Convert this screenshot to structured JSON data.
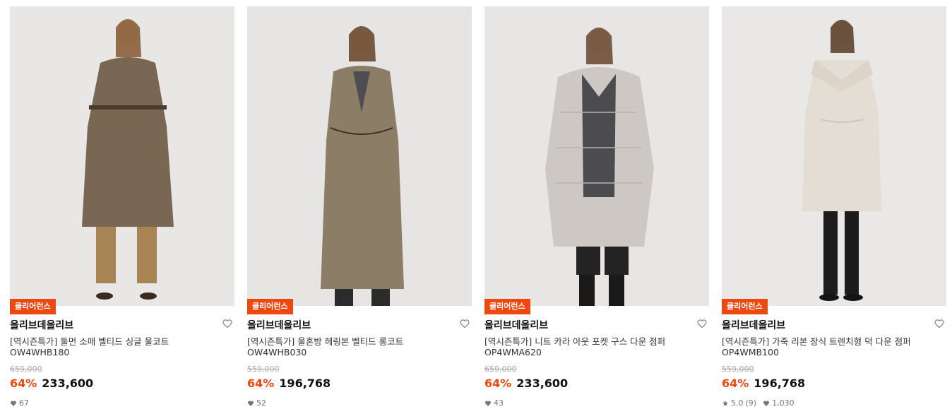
{
  "products": [
    {
      "badge": "클리어런스",
      "brand": "올리브데올리브",
      "name": "[역시즌특가] 둘먼 소매 벨티드 싱글 울코트",
      "code": "OW4WHB180",
      "original_price": "659,000",
      "discount_rate": "64%",
      "sale_price": "233,600",
      "likes": "67",
      "photo": {
        "bg": "#e8e7e5",
        "coat": "#7a6753",
        "pants": "#a88354",
        "shoe": "#3b2a20"
      }
    },
    {
      "badge": "클리어런스",
      "brand": "올리브데올리브",
      "name": "[역시즌특가] 울혼방 헤링본 벨티드 롱코트",
      "code": "OW4WHB030",
      "original_price": "559,000",
      "discount_rate": "64%",
      "sale_price": "196,768",
      "likes": "52",
      "photo": {
        "bg": "#e6e5e3",
        "coat": "#8c7d67",
        "pants": "#2b2b2b",
        "shoe": "#1e1e1e"
      }
    },
    {
      "badge": "클리어런스",
      "brand": "올리브데올리브",
      "name": "[역시즌특가] 니트 카라 아웃 포켓 구스 다운 점퍼",
      "code": "OP4WMA620",
      "original_price": "659,000",
      "discount_rate": "64%",
      "sale_price": "233,600",
      "likes": "43",
      "photo": {
        "bg": "#e7e6e4",
        "coat": "#cdc8c4",
        "pants": "#232323",
        "shoe": "#1a1a1a"
      }
    },
    {
      "badge": "클리어런스",
      "brand": "올리브데올리브",
      "name": "[역시즌특가] 가죽 리본 장식 트렌치형 덕 다운 점퍼",
      "code": "OP4WMB100",
      "original_price": "559,000",
      "discount_rate": "64%",
      "sale_price": "196,768",
      "rating": "5.0",
      "reviews": "(9)",
      "likes": "1,030",
      "photo": {
        "bg": "#e9e8e6",
        "coat": "#e4ddd3",
        "pants": "#1c1c1c",
        "shoe": "#151515"
      }
    }
  ],
  "icons": {
    "wishlist": "heart-outline-icon",
    "likes": "heart-filled-icon",
    "rating": "star-icon"
  },
  "colors": {
    "accent": "#ee4710",
    "strike": "#aaaaaa",
    "meta": "#777777"
  }
}
